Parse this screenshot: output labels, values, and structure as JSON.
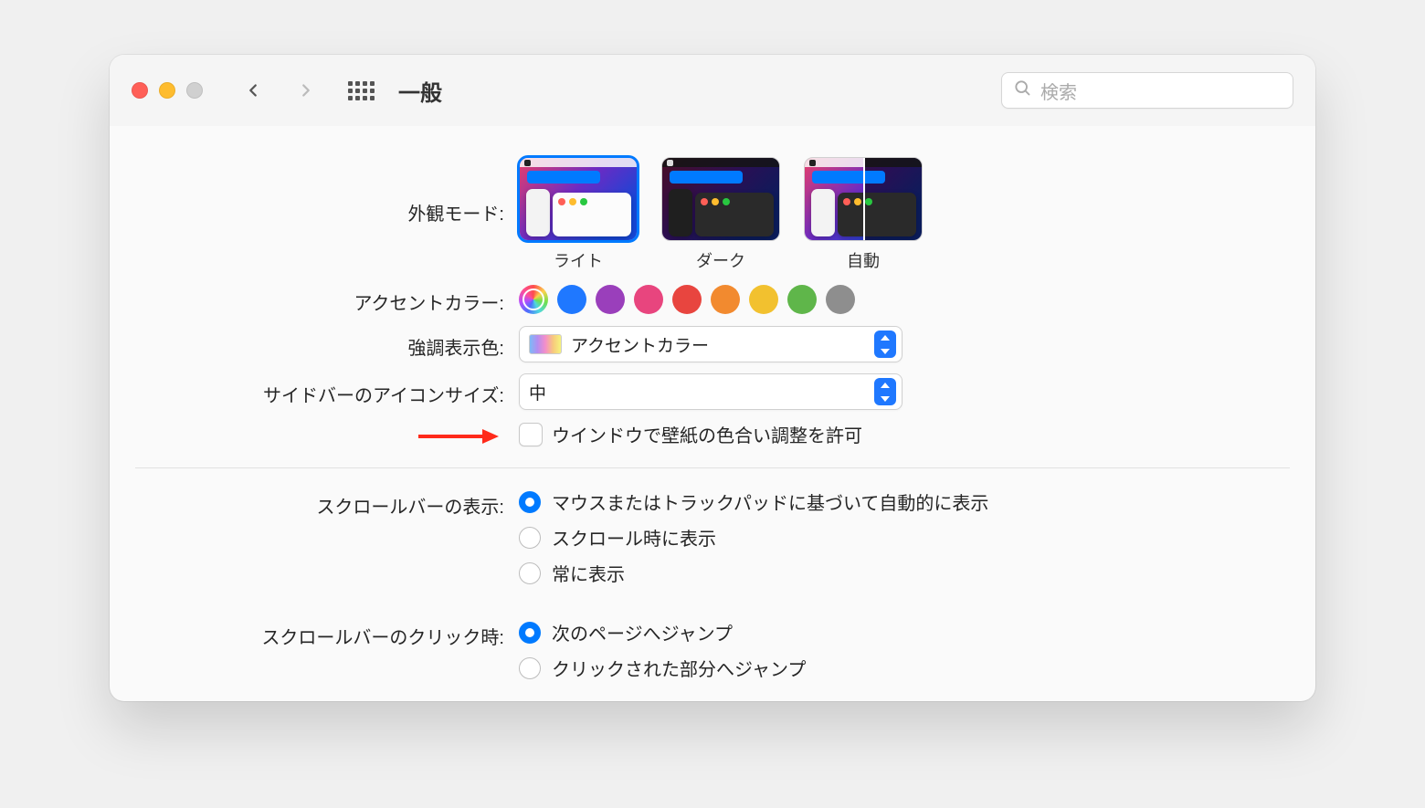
{
  "toolbar": {
    "title": "一般",
    "search_placeholder": "検索"
  },
  "appearance": {
    "label": "外観モード:",
    "options": [
      {
        "id": "light",
        "caption": "ライト",
        "selected": true
      },
      {
        "id": "dark",
        "caption": "ダーク",
        "selected": false
      },
      {
        "id": "auto",
        "caption": "自動",
        "selected": false
      }
    ]
  },
  "accent": {
    "label": "アクセントカラー:",
    "colors": [
      {
        "id": "multicolor",
        "hex": "multicolor",
        "selected": true
      },
      {
        "id": "blue",
        "hex": "#1f78ff"
      },
      {
        "id": "purple",
        "hex": "#9a3fbb"
      },
      {
        "id": "pink",
        "hex": "#e8457e"
      },
      {
        "id": "red",
        "hex": "#e8453f"
      },
      {
        "id": "orange",
        "hex": "#f28a2f"
      },
      {
        "id": "yellow",
        "hex": "#f2c12f"
      },
      {
        "id": "green",
        "hex": "#5fb64a"
      },
      {
        "id": "graphite",
        "hex": "#8e8e8e"
      }
    ]
  },
  "highlight": {
    "label": "強調表示色:",
    "value": "アクセントカラー"
  },
  "sidebar_icon": {
    "label": "サイドバーのアイコンサイズ:",
    "value": "中"
  },
  "wallpaper_tint": {
    "label": "ウインドウで壁紙の色合い調整を許可",
    "checked": false
  },
  "scrollbar_show": {
    "label": "スクロールバーの表示:",
    "options": [
      {
        "label": "マウスまたはトラックパッドに基づいて自動的に表示",
        "checked": true
      },
      {
        "label": "スクロール時に表示",
        "checked": false
      },
      {
        "label": "常に表示",
        "checked": false
      }
    ]
  },
  "scrollbar_click": {
    "label": "スクロールバーのクリック時:",
    "options": [
      {
        "label": "次のページへジャンプ",
        "checked": true
      },
      {
        "label": "クリックされた部分へジャンプ",
        "checked": false
      }
    ]
  }
}
